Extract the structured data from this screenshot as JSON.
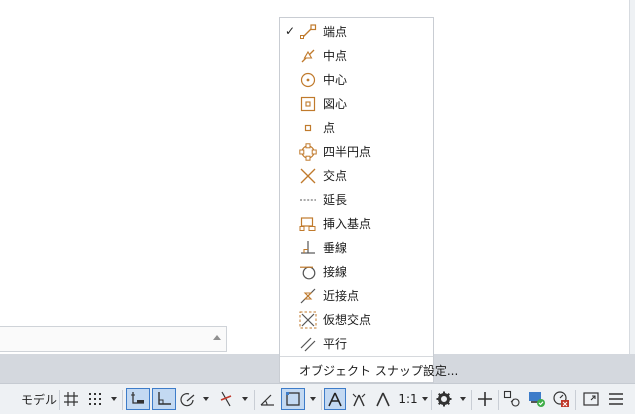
{
  "osnap_menu": {
    "items": [
      {
        "label": "端点",
        "checked": true,
        "icon": "endpoint-icon"
      },
      {
        "label": "中点",
        "checked": false,
        "icon": "midpoint-icon"
      },
      {
        "label": "中心",
        "checked": false,
        "icon": "center-icon"
      },
      {
        "label": "図心",
        "checked": false,
        "icon": "centroid-icon"
      },
      {
        "label": "点",
        "checked": false,
        "icon": "node-icon"
      },
      {
        "label": "四半円点",
        "checked": false,
        "icon": "quadrant-icon"
      },
      {
        "label": "交点",
        "checked": false,
        "icon": "intersection-icon"
      },
      {
        "label": "延長",
        "checked": false,
        "icon": "extension-icon"
      },
      {
        "label": "挿入基点",
        "checked": false,
        "icon": "insertion-icon"
      },
      {
        "label": "垂線",
        "checked": false,
        "icon": "perpendicular-icon"
      },
      {
        "label": "接線",
        "checked": false,
        "icon": "tangent-icon"
      },
      {
        "label": "近接点",
        "checked": false,
        "icon": "nearest-icon"
      },
      {
        "label": "仮想交点",
        "checked": false,
        "icon": "apparent-intersection-icon"
      },
      {
        "label": "平行",
        "checked": false,
        "icon": "parallel-icon"
      }
    ],
    "check_mark": "✓",
    "settings_label": "オブジェクト スナップ設定..."
  },
  "statusbar": {
    "model_label": "モデル",
    "scale_label": "1:1"
  },
  "colors": {
    "accent": "#3d7cc9",
    "snap_icon": "#c07a2c",
    "active_bg": "#c3d9f2"
  }
}
